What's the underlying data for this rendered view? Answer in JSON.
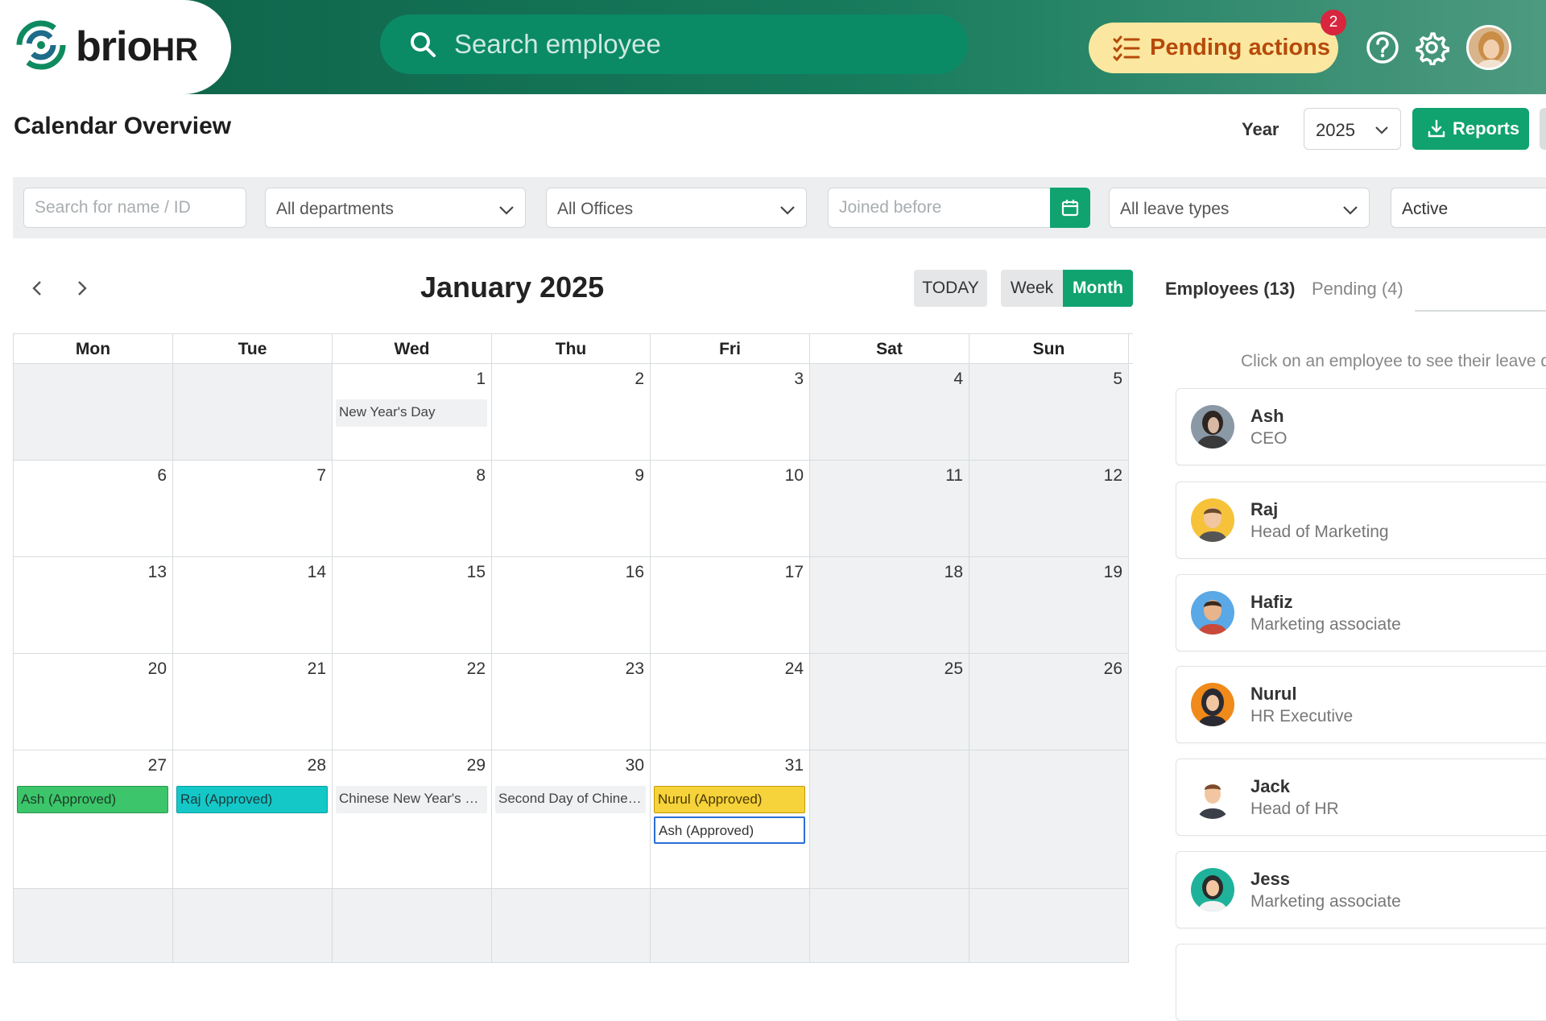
{
  "header": {
    "logo_main": "brio",
    "logo_hr": "HR",
    "search_placeholder": "Search employee",
    "pending_label": "Pending actions",
    "pending_count": "2",
    "colors": {
      "brand": "#0e6147",
      "accent": "#10a36f",
      "pending_bg": "#fbe7a0",
      "pending_text": "#b64a0a",
      "badge": "#d7263d"
    }
  },
  "toolbar": {
    "title": "Calendar Overview",
    "year_label": "Year",
    "year_value": "2025",
    "reports_label": "Reports"
  },
  "filters": {
    "search_placeholder": "Search for name / ID",
    "departments": "All departments",
    "offices": "All Offices",
    "joined_placeholder": "Joined before",
    "leave_types": "All leave types",
    "status": "Active"
  },
  "calendar": {
    "title": "January 2025",
    "today_label": "TODAY",
    "week_label": "Week",
    "month_label": "Month",
    "weekdays": [
      "Mon",
      "Tue",
      "Wed",
      "Thu",
      "Fri",
      "Sat",
      "Sun"
    ],
    "weeks": [
      [
        "",
        "",
        "1",
        "2",
        "3",
        "4",
        "5"
      ],
      [
        "6",
        "7",
        "8",
        "9",
        "10",
        "11",
        "12"
      ],
      [
        "13",
        "14",
        "15",
        "16",
        "17",
        "18",
        "19"
      ],
      [
        "20",
        "21",
        "22",
        "23",
        "24",
        "25",
        "26"
      ],
      [
        "27",
        "28",
        "29",
        "30",
        "31",
        "",
        ""
      ],
      [
        "",
        "",
        "",
        "",
        "",
        "",
        ""
      ]
    ],
    "events": {
      "new_year": "New Year's Day",
      "ash_27": "Ash (Approved)",
      "raj_28": "Raj (Approved)",
      "cny_29": "Chinese New Year's Day",
      "cny_30": "Second Day of Chinese New Year",
      "nurul_31": "Nurul (Approved)",
      "ash_31": "Ash (Approved)"
    }
  },
  "sidebar": {
    "tab_employees": "Employees (13)",
    "tab_pending": "Pending (4)",
    "hint": "Click on an employee to see their leave d",
    "employees": [
      {
        "name": "Ash",
        "role": "CEO"
      },
      {
        "name": "Raj",
        "role": "Head of Marketing"
      },
      {
        "name": "Hafiz",
        "role": "Marketing associate"
      },
      {
        "name": "Nurul",
        "role": "HR Executive"
      },
      {
        "name": "Jack",
        "role": "Head of HR"
      },
      {
        "name": "Jess",
        "role": "Marketing associate"
      }
    ]
  }
}
